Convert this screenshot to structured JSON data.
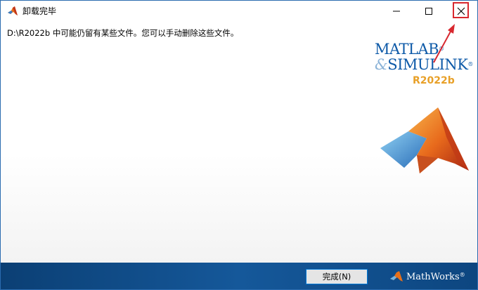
{
  "window": {
    "title": "卸载完毕"
  },
  "controls": {
    "minimize": "minimize-icon",
    "maximize": "maximize-icon",
    "close": "close-icon"
  },
  "main": {
    "message": "D:\\R2022b 中可能仍留有某些文件。您可以手动删除这些文件。"
  },
  "brand": {
    "line1": "MATLAB",
    "amp": "&",
    "line2": "SIMULINK",
    "reg": "®",
    "version": "R2022b"
  },
  "footer": {
    "finish_label": "完成(N)",
    "company": "MathWorks",
    "company_reg": "®"
  },
  "colors": {
    "brand_blue": "#0e5aa8",
    "version_orange": "#e8a028",
    "footer_blue": "#15589a",
    "highlight_red": "#d8282f"
  }
}
